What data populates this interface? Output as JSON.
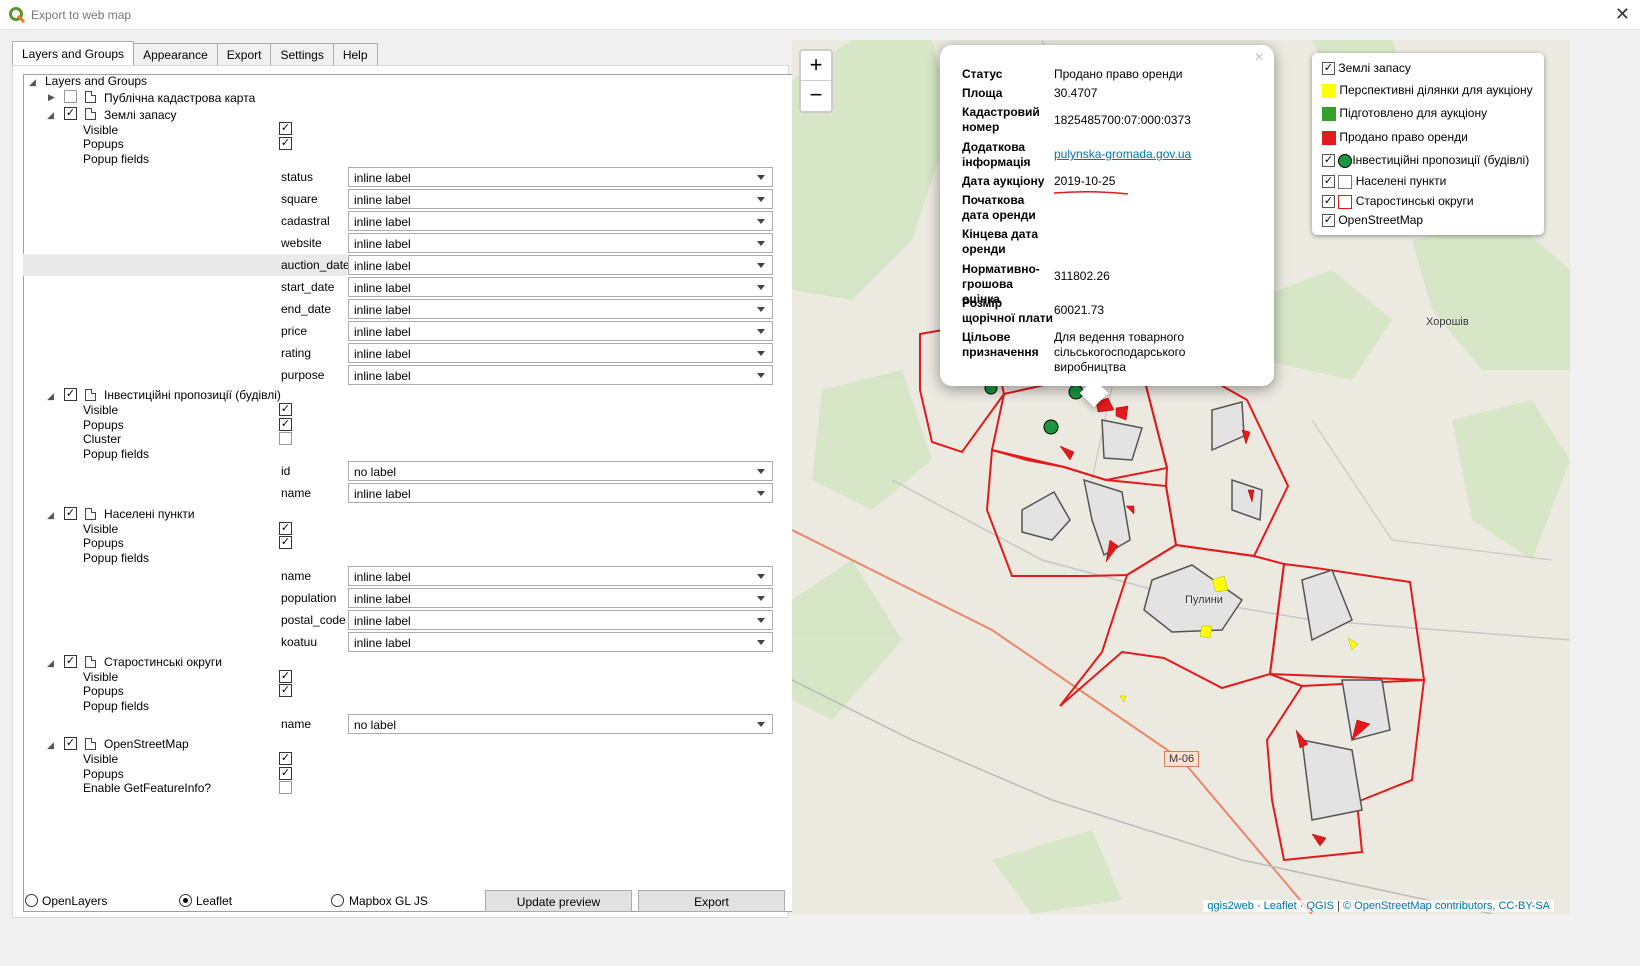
{
  "window": {
    "title": "Export to web map",
    "close": "✕"
  },
  "tabs": [
    "Layers and Groups",
    "Appearance",
    "Export",
    "Settings",
    "Help"
  ],
  "tree": {
    "root": "Layers and Groups",
    "layer_public": "Публічна кадастрова карта",
    "layer_land": "Землі запасу",
    "layer_invest": "Інвестиційні пропозиції (будівлі)",
    "layer_settle": "Населені пункти",
    "layer_starost": "Старостинські округи",
    "layer_osm": "OpenStreetMap",
    "visible": "Visible",
    "popups": "Popups",
    "popup_fields": "Popup fields",
    "cluster": "Cluster",
    "enable_gfi": "Enable GetFeatureInfo?",
    "land_fields": [
      "status",
      "square",
      "cadastral",
      "website",
      "auction_date",
      "start_date",
      "end_date",
      "price",
      "rating",
      "purpose"
    ],
    "land_values": [
      "inline label",
      "inline label",
      "inline label",
      "inline label",
      "inline label",
      "inline label",
      "inline label",
      "inline label",
      "inline label",
      "inline label"
    ],
    "invest_fields": [
      "id",
      "name"
    ],
    "invest_values": [
      "no label",
      "inline label"
    ],
    "settle_fields": [
      "name",
      "population",
      "postal_code",
      "koatuu"
    ],
    "settle_values": [
      "inline label",
      "inline label",
      "inline label",
      "inline label"
    ],
    "starost_fields": [
      "name"
    ],
    "starost_values": [
      "no label"
    ]
  },
  "bottom": {
    "openlayers": "OpenLayers",
    "leaflet": "Leaflet",
    "mapbox": "Mapbox GL JS",
    "update": "Update preview",
    "export": "Export"
  },
  "popup": {
    "close": "×",
    "k1": "Статус",
    "v1": "Продано право оренди",
    "k2": "Площа",
    "v2": "30.4707",
    "k3": "Кадастровий номер",
    "v3": "1825485700:07:000:0373",
    "k4": "Додаткова інформація",
    "v4": "pulynska-gromada.gov.ua",
    "k5": "Дата аукціону",
    "v5": "2019-10-25",
    "k6": "Початкова дата оренди",
    "k7": "Кінцева дата оренди",
    "k8": "Нормативно-грошова оцінка",
    "v8": "311802.26",
    "k9": "Розмір щорічної плати",
    "v9": "60021.73",
    "k10": "Цільове призначення",
    "v10": "Для ведення товарного сільськогосподарського виробництва"
  },
  "legend": {
    "l1": "Землі запасу",
    "l2": "Перспективні ділянки для аукціону",
    "l3": "Підготовлено для аукціону",
    "l4": "Продано право оренди",
    "l5": "Інвестиційні пропозиції (будівлі)",
    "l6": "Населені пункти",
    "l7": "Старостинські округи",
    "l8": "OpenStreetMap"
  },
  "map": {
    "zoom_in": "+",
    "zoom_out": "−",
    "town_pulyny": "Пулини",
    "town_khoroshiv": "Хорошів",
    "road": "М-06",
    "attrib_qgis2web": "qgis2web",
    "attrib_leaflet": "Leaflet",
    "attrib_qgis": "QGIS",
    "attrib_osm": "© OpenStreetMap contributors, CC-BY-SA"
  },
  "colors": {
    "sold": "#e31a1c",
    "prepared": "#33a02c",
    "prospective": "#ffff00",
    "border": "#e31a1c"
  }
}
